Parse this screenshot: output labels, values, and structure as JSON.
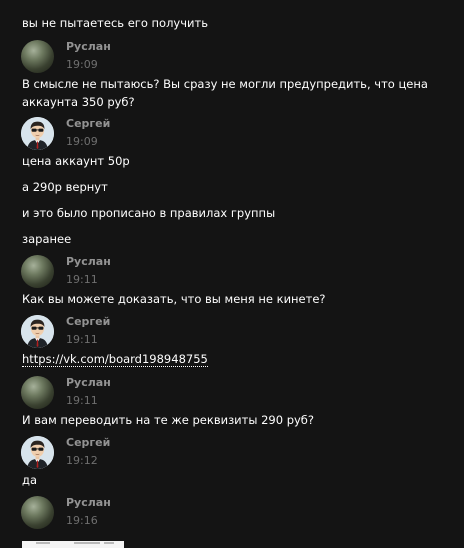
{
  "messages": [
    {
      "text": "вы не пытаетесь его получить"
    },
    {
      "author": "Руслан",
      "time": "19:09",
      "avatar_icon": "planet-avatar",
      "text": "В смысле не пытаюсь? Вы сразу не могли предупредить, что цена аккаунта 350 руб?"
    },
    {
      "author": "Сергей",
      "time": "19:09",
      "avatar_icon": "cartoon-man-avatar",
      "texts": [
        "цена аккаунт 50р",
        "а 290р вернут",
        "и это было прописано в правилах группы",
        "заранее"
      ]
    },
    {
      "author": "Руслан",
      "time": "19:11",
      "avatar_icon": "planet-avatar",
      "text": "Как вы можете доказать, что вы меня не кинете?"
    },
    {
      "author": "Сергей",
      "time": "19:11",
      "avatar_icon": "cartoon-man-avatar",
      "link": "https://vk.com/board198948755"
    },
    {
      "author": "Руслан",
      "time": "19:11",
      "avatar_icon": "planet-avatar",
      "text": "И вам переводить на те же реквизиты 290 руб?"
    },
    {
      "author": "Сергей",
      "time": "19:12",
      "avatar_icon": "cartoon-man-avatar",
      "text": "да"
    },
    {
      "author": "Руслан",
      "time": "19:16",
      "avatar_icon": "planet-avatar",
      "attachment_icon": "image-preview-icon"
    }
  ],
  "colors": {
    "background": "#141414",
    "author": "#939393",
    "time": "#6f6f6f",
    "text": "#ffffff"
  }
}
